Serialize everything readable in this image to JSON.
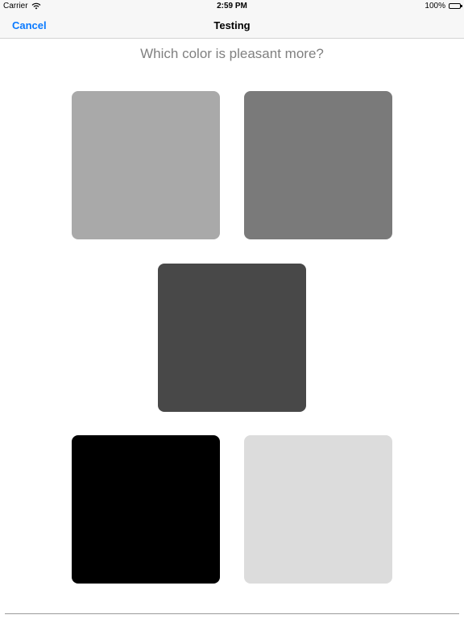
{
  "status_bar": {
    "carrier": "Carrier",
    "time": "2:59 PM",
    "battery": "100%"
  },
  "nav": {
    "cancel_label": "Cancel",
    "title": "Testing",
    "accent_color": "#0a7aff"
  },
  "question": "Which color is pleasant more?",
  "swatches": [
    {
      "id": "swatch-1",
      "color": "#a9a9a9"
    },
    {
      "id": "swatch-2",
      "color": "#7a7a7a"
    },
    {
      "id": "swatch-3",
      "color": "#484848"
    },
    {
      "id": "swatch-4",
      "color": "#000000"
    },
    {
      "id": "swatch-5",
      "color": "#dcdcdc"
    }
  ]
}
